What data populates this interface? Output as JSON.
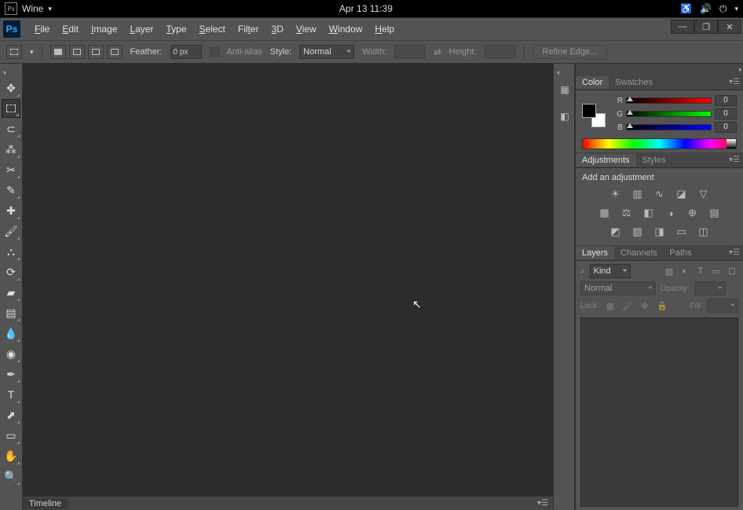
{
  "sysbar": {
    "app_icon": "Ps",
    "app_name": "Wine",
    "datetime": "Apr 13  11:39"
  },
  "menubar": {
    "logo": "Ps",
    "items": [
      {
        "label": "File",
        "accel": "F"
      },
      {
        "label": "Edit",
        "accel": "E"
      },
      {
        "label": "Image",
        "accel": "I"
      },
      {
        "label": "Layer",
        "accel": "L"
      },
      {
        "label": "Type",
        "accel": "T"
      },
      {
        "label": "Select",
        "accel": "S"
      },
      {
        "label": "Filter",
        "accel": "t"
      },
      {
        "label": "3D",
        "accel": "3"
      },
      {
        "label": "View",
        "accel": "V"
      },
      {
        "label": "Window",
        "accel": "W"
      },
      {
        "label": "Help",
        "accel": "H"
      }
    ]
  },
  "options": {
    "feather_label": "Feather:",
    "feather_value": "0 px",
    "antialias_label": "Anti-alias",
    "style_label": "Style:",
    "style_value": "Normal",
    "width_label": "Width:",
    "height_label": "Height:",
    "refine_label": "Refine Edge..."
  },
  "panels": {
    "color": {
      "tab": "Color",
      "tab2": "Swatches",
      "rlabel": "R",
      "glabel": "G",
      "blabel": "B",
      "r": "0",
      "g": "0",
      "b": "0"
    },
    "adjustments": {
      "tab": "Adjustments",
      "tab2": "Styles",
      "hint": "Add an adjustment"
    },
    "layers": {
      "tab": "Layers",
      "tab2": "Channels",
      "tab3": "Paths",
      "kind_label": "Kind",
      "blend_mode": "Normal",
      "opacity_label": "Opacity:",
      "lock_label": "Lock:",
      "fill_label": "Fill:"
    }
  },
  "timeline": {
    "label": "Timeline"
  }
}
